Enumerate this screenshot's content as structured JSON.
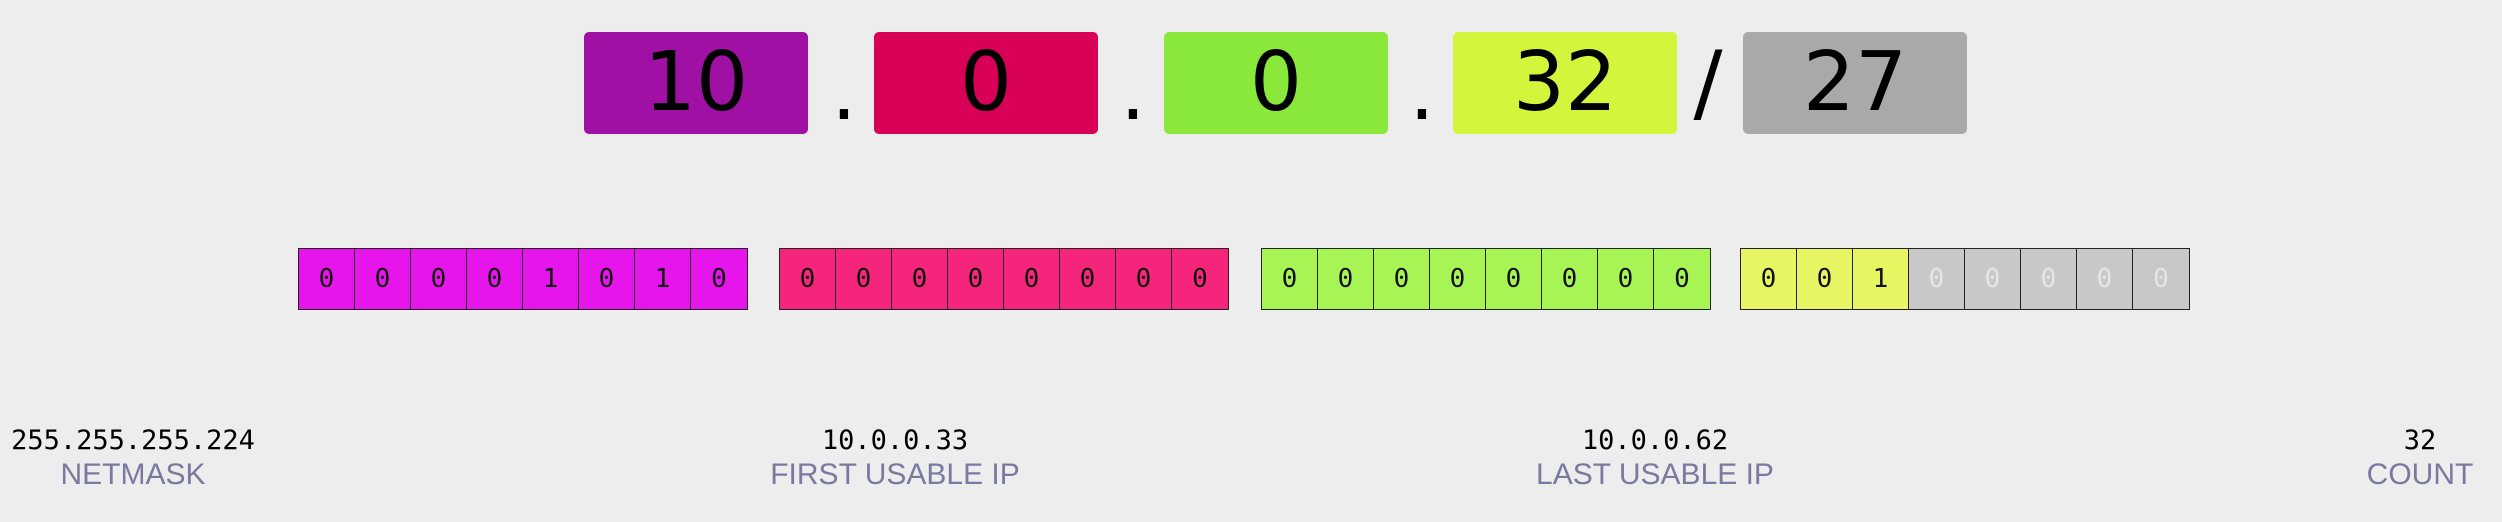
{
  "cidr": {
    "octets": [
      {
        "value": "10",
        "color": "#a010a5"
      },
      {
        "value": "0",
        "color": "#d80057"
      },
      {
        "value": "0",
        "color": "#8ae83a"
      },
      {
        "value": "32",
        "color": "#d3f53c"
      }
    ],
    "separator_dot": ".",
    "separator_slash": "/",
    "prefix": {
      "value": "27",
      "color": "#a9a9a9"
    }
  },
  "bits": {
    "groups": [
      {
        "color": "#e515ec",
        "bits": [
          "0",
          "0",
          "0",
          "0",
          "1",
          "0",
          "1",
          "0"
        ]
      },
      {
        "color": "#f5257b",
        "bits": [
          "0",
          "0",
          "0",
          "0",
          "0",
          "0",
          "0",
          "0"
        ]
      },
      {
        "color": "#a7f455",
        "bits": [
          "0",
          "0",
          "0",
          "0",
          "0",
          "0",
          "0",
          "0"
        ]
      },
      {
        "color": "#e6f561",
        "bits": [
          "0",
          "0",
          "1",
          "0",
          "0",
          "0",
          "0",
          "0"
        ]
      }
    ],
    "host_color": "#c8c8c8",
    "prefix_length": 27
  },
  "details": {
    "netmask": {
      "value": "255.255.255.224",
      "label": "NETMASK"
    },
    "first_usable": {
      "value": "10.0.0.33",
      "label": "FIRST USABLE IP"
    },
    "last_usable": {
      "value": "10.0.0.62",
      "label": "LAST USABLE IP"
    },
    "count": {
      "value": "32",
      "label": "COUNT"
    }
  }
}
